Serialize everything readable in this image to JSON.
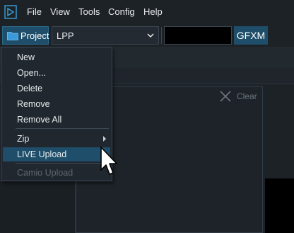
{
  "menubar": {
    "items": [
      "File",
      "View",
      "Tools",
      "Config",
      "Help"
    ]
  },
  "toolbar": {
    "project_label": "Project",
    "project_value": "LPP",
    "gfxm_label": "GFXM"
  },
  "panel": {
    "clear_label": "Clear"
  },
  "project_menu": {
    "items": [
      {
        "label": "New",
        "enabled": true
      },
      {
        "label": "Open...",
        "enabled": true
      },
      {
        "label": "Delete",
        "enabled": true
      },
      {
        "label": "Remove",
        "enabled": true
      },
      {
        "label": "Remove All",
        "enabled": true
      },
      {
        "label": "Zip",
        "enabled": true,
        "submenu": true
      },
      {
        "label": "LIVE Upload",
        "enabled": true,
        "highlighted": true
      },
      {
        "label": "Camio Upload",
        "enabled": false
      }
    ]
  },
  "colors": {
    "accent": "#1e4e6a",
    "background": "#1d2227",
    "menu_bg": "#20272e",
    "disabled_text": "#5d6770"
  }
}
